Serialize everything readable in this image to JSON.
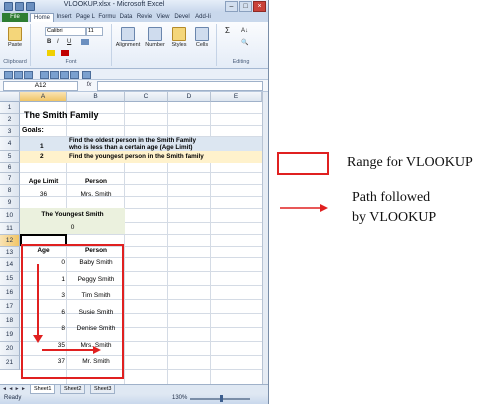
{
  "window": {
    "title": "VLOOKUP.xlsx - Microsoft Excel",
    "controls": [
      "–",
      "□",
      "×"
    ]
  },
  "ribbon": {
    "tabs": [
      "File",
      "Home",
      "Insert",
      "Page L",
      "Formu",
      "Data",
      "Revie",
      "View",
      "Devel",
      "Add-Ii"
    ],
    "active_tab": "Home",
    "groups": [
      {
        "label": "Clipboard",
        "buttons": [
          "Paste"
        ]
      },
      {
        "label": "Font",
        "font_name": "Calibri",
        "font_size": "11",
        "buttons": [
          "B",
          "I",
          "U"
        ]
      },
      {
        "label": "",
        "buttons": [
          "Alignment",
          "Number",
          "Styles",
          "Cells"
        ]
      },
      {
        "label": "Editing",
        "buttons": [
          "Σ",
          "A↓",
          "🔍"
        ]
      }
    ]
  },
  "formula_bar": {
    "name_box": "A12",
    "fx": "fx",
    "formula": ""
  },
  "grid": {
    "columns": [
      "A",
      "B",
      "C",
      "D",
      "E"
    ],
    "selected_column": "A",
    "rows": [
      "1",
      "2",
      "3",
      "4",
      "5",
      "6",
      "7",
      "8",
      "9",
      "10",
      "11",
      "12",
      "13",
      "14",
      "15",
      "16",
      "17",
      "18",
      "19",
      "20",
      "21"
    ],
    "selected_row": "12",
    "cells": {
      "title": "The Smith Family",
      "goals": "Goals:",
      "goal1_num": "1",
      "goal1_line1": "Find the oldest person in the Smith Family",
      "goal1_line2": "who is less than a certain age (Age Limit)",
      "goal2_num": "2",
      "goal2_text": "Find the youngest person in the Smith family",
      "age_limit_hdr": "Age Limit",
      "person_hdr": "Person",
      "age_limit_val": "36",
      "age_limit_person": "Mrs. Smith",
      "youngest_hdr": "The Youngest Smith",
      "youngest_val": "0",
      "age_hdr": "Age",
      "person_hdr2": "Person"
    },
    "table": [
      {
        "age": "0",
        "person": "Baby Smith"
      },
      {
        "age": "1",
        "person": "Peggy Smith"
      },
      {
        "age": "3",
        "person": "Tim Smith"
      },
      {
        "age": "6",
        "person": "Susie Smith"
      },
      {
        "age": "8",
        "person": "Denise Smith"
      },
      {
        "age": "35",
        "person": "Mrs. Smith"
      },
      {
        "age": "37",
        "person": "Mr. Smith"
      }
    ]
  },
  "sheets": {
    "tabs": [
      "Sheet1",
      "Sheet2",
      "Sheet3"
    ],
    "active": "Sheet1"
  },
  "status": {
    "text": "Ready",
    "zoom": "130%"
  },
  "legend": {
    "range_label": "Range for VLOOKUP",
    "path_line1": "Path followed",
    "path_line2": "by VLOOKUP",
    "accent_color": "#e02020"
  },
  "colors": {
    "header_fill": "#ebf1de",
    "goal_fill": "#dce6f1",
    "goal2_fill": "#fff2cc",
    "highlight_red": "#e02020"
  }
}
